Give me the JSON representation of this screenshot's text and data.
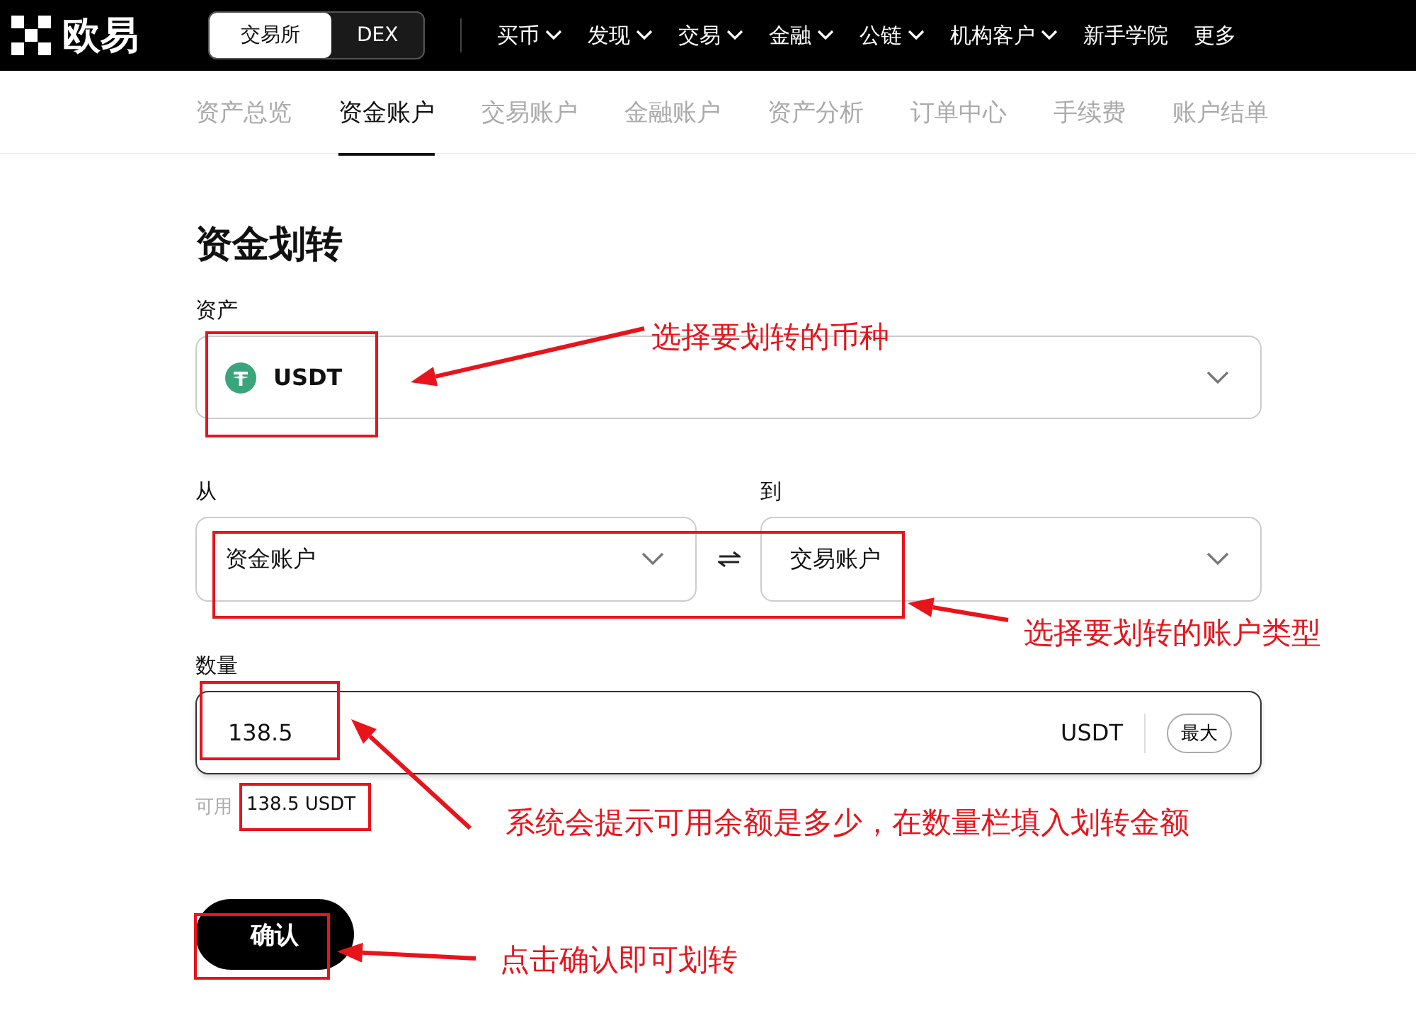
{
  "header": {
    "logo": "欧易",
    "mode_toggle": [
      {
        "label": "交易所",
        "selected": true
      },
      {
        "label": "DEX",
        "selected": false
      }
    ],
    "nav": [
      {
        "label": "买币",
        "has_menu": true
      },
      {
        "label": "发现",
        "has_menu": true
      },
      {
        "label": "交易",
        "has_menu": true
      },
      {
        "label": "金融",
        "has_menu": true
      },
      {
        "label": "公链",
        "has_menu": true
      },
      {
        "label": "机构客户",
        "has_menu": true
      },
      {
        "label": "新手学院",
        "has_menu": false
      },
      {
        "label": "更多",
        "has_menu": false
      }
    ]
  },
  "tabs": [
    {
      "label": "资产总览",
      "selected": false
    },
    {
      "label": "资金账户",
      "selected": true
    },
    {
      "label": "交易账户",
      "selected": false
    },
    {
      "label": "金融账户",
      "selected": false
    },
    {
      "label": "资产分析",
      "selected": false
    },
    {
      "label": "订单中心",
      "selected": false
    },
    {
      "label": "手续费",
      "selected": false
    },
    {
      "label": "账户结单",
      "selected": false
    }
  ],
  "form": {
    "title": "资金划转",
    "asset": {
      "label": "资产",
      "value": "USDT"
    },
    "from": {
      "label": "从",
      "value": "资金账户"
    },
    "to": {
      "label": "到",
      "value": "交易账户"
    },
    "amount": {
      "label": "数量",
      "value": "138.5",
      "unit": "USDT",
      "max_button": "最大"
    },
    "available": {
      "label": "可用",
      "value": "138.5 USDT"
    },
    "confirm_button": "确认"
  },
  "annotations": [
    {
      "text": "选择要划转的币种"
    },
    {
      "text": "选择要划转的账户类型"
    },
    {
      "text": "系统会提示可用余额是多少，在数量栏填入划转金额"
    },
    {
      "text": "点击确认即可划转"
    }
  ]
}
